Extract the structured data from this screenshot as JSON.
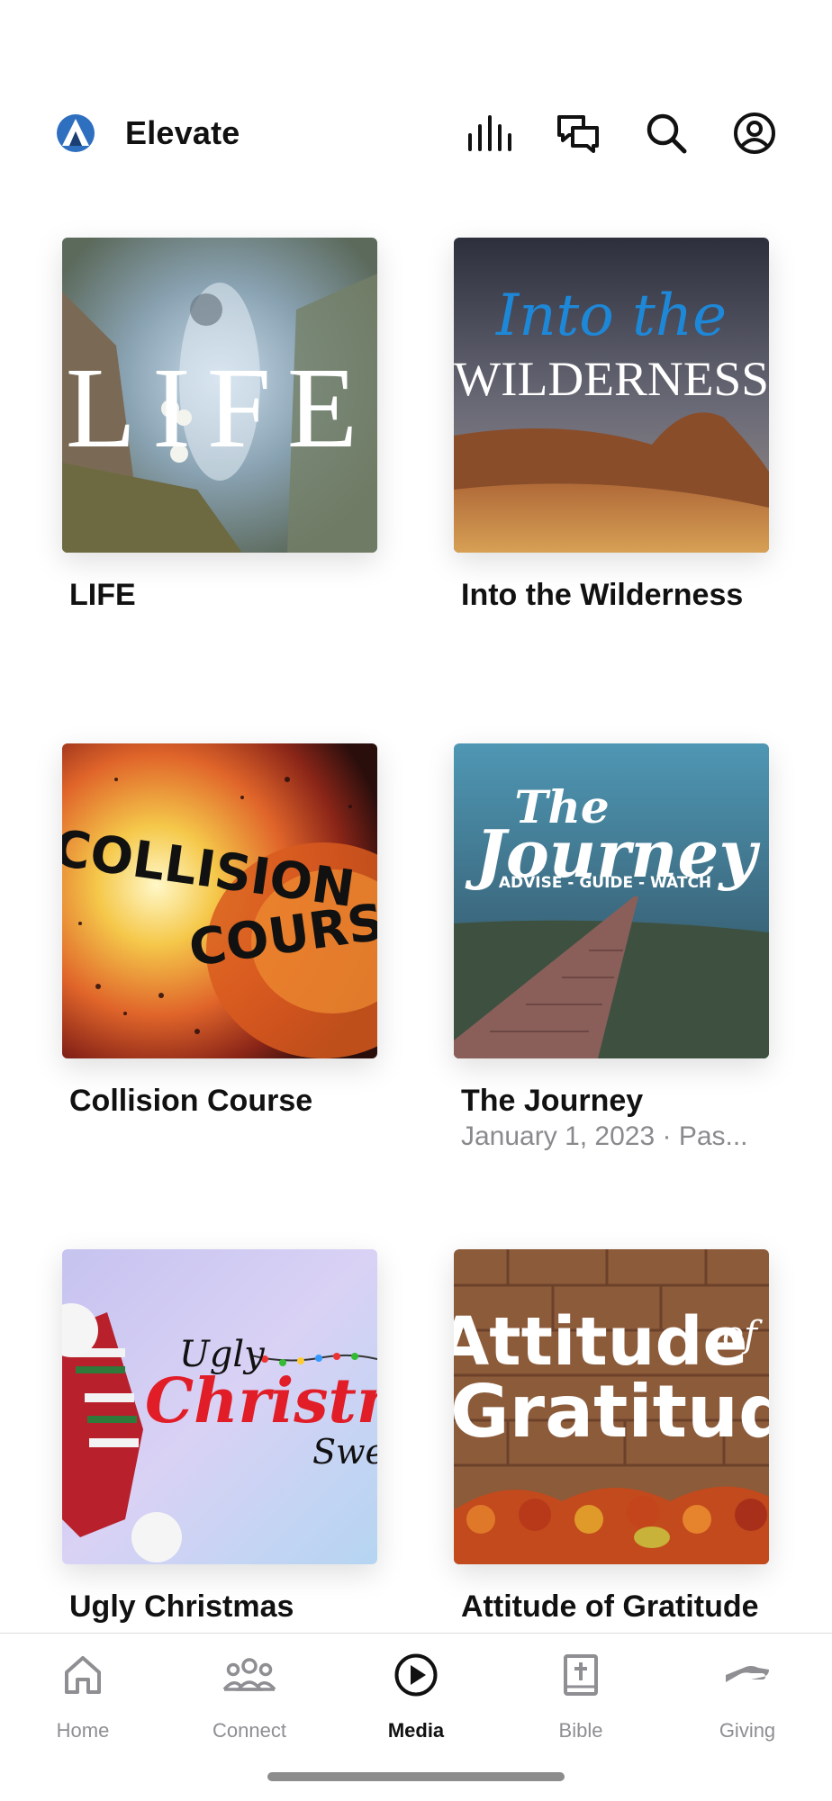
{
  "header": {
    "title": "Elevate",
    "icons": [
      "logo-icon",
      "audio-bars-icon",
      "chat-icon",
      "search-icon",
      "profile-icon"
    ]
  },
  "media_items": [
    {
      "title": "LIFE",
      "subtitle": "",
      "artwork_text": "LIFE"
    },
    {
      "title": "Into the Wilderness",
      "subtitle": "",
      "artwork_script": "Into the",
      "artwork_text": "WILDERNESS"
    },
    {
      "title": "Collision Course",
      "subtitle": "",
      "artwork_text_1": "COLLISION",
      "artwork_text_2": "COURSE"
    },
    {
      "title": "The Journey",
      "subtitle": "January 1, 2023 · Pas...",
      "artwork_text_1": "The",
      "artwork_text_2": "Journey",
      "artwork_tagline": "ADVISE - GUIDE - WATCH"
    },
    {
      "title": "Ugly Christmas Sweater",
      "subtitle": "",
      "artwork_text_1": "Ugly",
      "artwork_text_2": "Christmas",
      "artwork_text_3": "Sweater"
    },
    {
      "title": "Attitude of Gratitude",
      "subtitle": "",
      "artwork_text_1": "Attitude",
      "artwork_text_2": "of",
      "artwork_text_3": "Gratitude"
    }
  ],
  "tabbar": {
    "tabs": [
      {
        "label": "Home",
        "icon": "house-icon",
        "active": false
      },
      {
        "label": "Connect",
        "icon": "people-icon",
        "active": false
      },
      {
        "label": "Media",
        "icon": "play-circle-icon",
        "active": true
      },
      {
        "label": "Bible",
        "icon": "bible-icon",
        "active": false
      },
      {
        "label": "Giving",
        "icon": "giving-hand-icon",
        "active": false
      }
    ]
  },
  "colors": {
    "accent": "#111111",
    "inactive": "#8e8e93",
    "logo_blue": "#2f6fc0"
  }
}
